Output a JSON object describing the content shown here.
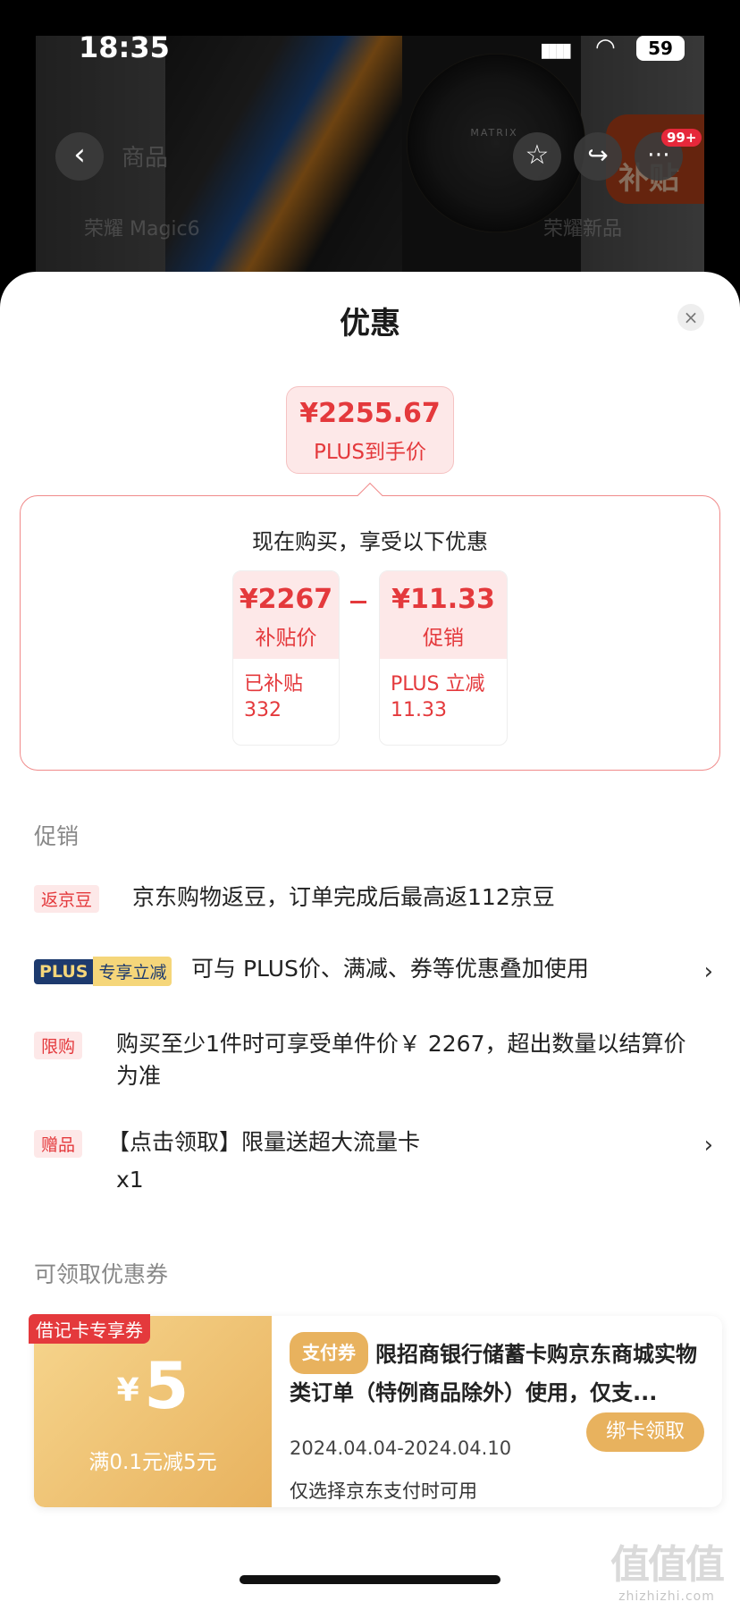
{
  "status_bar": {
    "time": "18:35",
    "signal": "▮▮▮▮",
    "wifi": "◠",
    "battery": "59"
  },
  "background": {
    "nav_tab_ghost": "商品",
    "search_ghost": "荣耀 Magic6",
    "search_ghost_right": "荣耀新品",
    "lens_text": "MATRIX",
    "subsidy_badge": "补贴",
    "cart_badge": "99+"
  },
  "sheet": {
    "title": "优惠",
    "close_symbol": "×"
  },
  "final_price": {
    "value": "¥2255.67",
    "label": "PLUS到手价"
  },
  "calc": {
    "heading": "现在购买，享受以下优惠",
    "cards": [
      {
        "value": "¥2267",
        "label": "补贴价",
        "detail": "已补贴\n332"
      },
      {
        "value": "¥11.33",
        "label": "促销",
        "detail": "PLUS 立减\n11.33"
      }
    ]
  },
  "promotions": {
    "section_title": "促销",
    "items": [
      {
        "tag": "返京豆",
        "text": "京东购物返豆，订单完成后最高返112京豆"
      },
      {
        "tag_left": "PLUS",
        "tag_right": "专享立减",
        "text": "可与 PLUS价、满减、券等优惠叠加使用",
        "chevron": "›"
      },
      {
        "tag": "限购",
        "text": "购买至少1件时可享受单件价￥ 2267，超出数量以结算价为准"
      },
      {
        "tag": "赠品",
        "text": "【点击领取】限量送超大流量卡",
        "sub": "x1",
        "chevron": "›"
      }
    ]
  },
  "coupons": {
    "section_title": "可领取优惠券",
    "items": [
      {
        "ribbon": "借记卡专享券",
        "currency": "¥",
        "amount": "5",
        "condition": "满0.1元减5元",
        "pay_tag": "支付券",
        "title": "限招商银行储蓄卡购京东商城实物类订单（特例商品除外）使用，仅支...",
        "date": "2024.04.04-2024.04.10",
        "note": "仅选择京东支付时可用",
        "button": "绑卡领取"
      }
    ]
  },
  "watermark": {
    "big": "值值值",
    "small": "zhizhizhi.com"
  },
  "colors": {
    "accent_red": "#e4393c",
    "coupon_gold": "#e8b25e",
    "plus_navy": "#1d3a6e"
  }
}
